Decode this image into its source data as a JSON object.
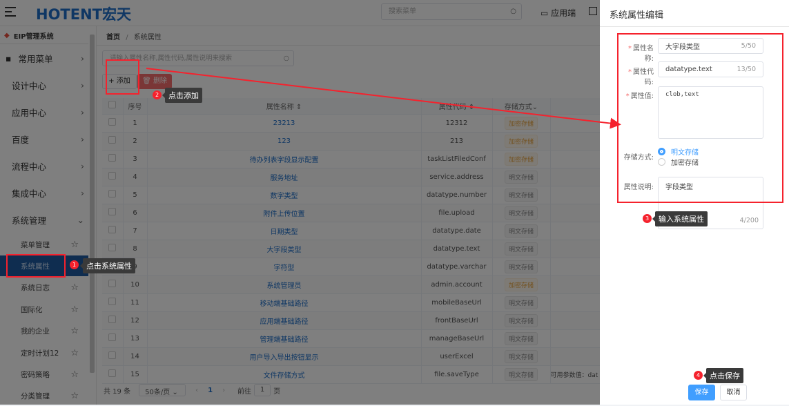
{
  "header": {
    "logo": "HOTENT宏天",
    "search_placeholder": "搜索菜单",
    "app_end_label": "应用端"
  },
  "sidebar": {
    "title": "EIP管理系统",
    "items": [
      {
        "label": "常用菜单"
      },
      {
        "label": "设计中心"
      },
      {
        "label": "应用中心"
      },
      {
        "label": "百度"
      },
      {
        "label": "流程中心"
      },
      {
        "label": "集成中心"
      },
      {
        "label": "系统管理"
      }
    ],
    "sub_items": [
      {
        "label": "菜单管理"
      },
      {
        "label": "系统属性",
        "active": true
      },
      {
        "label": "系统日志"
      },
      {
        "label": "国际化"
      },
      {
        "label": "我的企业"
      },
      {
        "label": "定时计划12"
      },
      {
        "label": "密码策略"
      },
      {
        "label": "分类管理"
      }
    ]
  },
  "breadcrumb": {
    "home": "首页",
    "sep": "/",
    "current": "系统属性"
  },
  "main": {
    "search_placeholder": "请输入属性名称,属性代码,属性说明来搜索",
    "add_label": "添加",
    "delete_label": "删除",
    "columns": {
      "index": "序号",
      "name": "属性名称",
      "code": "属性代码",
      "storage": "存储方式"
    },
    "rows": [
      {
        "no": "1",
        "name": "23213",
        "code": "12312",
        "storage": "加密存储",
        "enc": true,
        "extra": ""
      },
      {
        "no": "2",
        "name": "123",
        "code": "213",
        "storage": "加密存储",
        "enc": true,
        "extra": ""
      },
      {
        "no": "3",
        "name": "待办列表字段显示配置",
        "code": "taskListFiledConf",
        "storage": "加密存储",
        "enc": true,
        "extra": ""
      },
      {
        "no": "4",
        "name": "服务地址",
        "code": "service.address",
        "storage": "明文存储",
        "enc": false,
        "extra": ""
      },
      {
        "no": "5",
        "name": "数字类型",
        "code": "datatype.number",
        "storage": "明文存储",
        "enc": false,
        "extra": ""
      },
      {
        "no": "6",
        "name": "附件上传位置",
        "code": "file.upload",
        "storage": "明文存储",
        "enc": false,
        "extra": ""
      },
      {
        "no": "7",
        "name": "日期类型",
        "code": "datatype.date",
        "storage": "明文存储",
        "enc": false,
        "extra": ""
      },
      {
        "no": "8",
        "name": "大字段类型",
        "code": "datatype.text",
        "storage": "明文存储",
        "enc": false,
        "extra": ""
      },
      {
        "no": "9",
        "name": "字符型",
        "code": "datatype.varchar",
        "storage": "明文存储",
        "enc": false,
        "extra": ""
      },
      {
        "no": "10",
        "name": "系统管理员",
        "code": "admin.account",
        "storage": "加密存储",
        "enc": true,
        "extra": ""
      },
      {
        "no": "11",
        "name": "移动端基础路径",
        "code": "mobileBaseUrl",
        "storage": "明文存储",
        "enc": false,
        "extra": ""
      },
      {
        "no": "12",
        "name": "应用端基础路径",
        "code": "frontBaseUrl",
        "storage": "明文存储",
        "enc": false,
        "extra": ""
      },
      {
        "no": "13",
        "name": "管理端基础路径",
        "code": "manageBaseUrl",
        "storage": "明文存储",
        "enc": false,
        "extra": ""
      },
      {
        "no": "14",
        "name": "用户导入导出按钮显示",
        "code": "userExcel",
        "storage": "明文存储",
        "enc": false,
        "extra": ""
      },
      {
        "no": "15",
        "name": "文件存储方式",
        "code": "file.saveType",
        "storage": "明文存储",
        "enc": false,
        "extra": "可用参数值：dat"
      }
    ],
    "pagination": {
      "total": "共 19 条",
      "page_size": "50条/页",
      "current": "1",
      "goto_label": "前往",
      "goto_value": "1",
      "page_suffix": "页"
    }
  },
  "drawer": {
    "title": "系统属性编辑",
    "name_label": "属性名称:",
    "name_value": "大字段类型",
    "name_count": "5/50",
    "code_label": "属性代码:",
    "code_value": "datatype.text",
    "code_count": "13/50",
    "value_label": "属性值:",
    "value_value": "clob,text",
    "storage_label": "存储方式:",
    "storage_opt1": "明文存储",
    "storage_opt2": "加密存储",
    "desc_label": "属性说明:",
    "desc_value": "字段类型",
    "desc_count": "4/200",
    "save_label": "保存",
    "cancel_label": "取消"
  },
  "annotations": [
    {
      "n": "1",
      "text": "点击系统属性"
    },
    {
      "n": "2",
      "text": "点击添加"
    },
    {
      "n": "3",
      "text": "输入系统属性"
    },
    {
      "n": "4",
      "text": "点击保存"
    }
  ],
  "colors": {
    "primary": "#409eff",
    "active_menu": "#1e5aa0",
    "annotation": "#f5222d"
  }
}
